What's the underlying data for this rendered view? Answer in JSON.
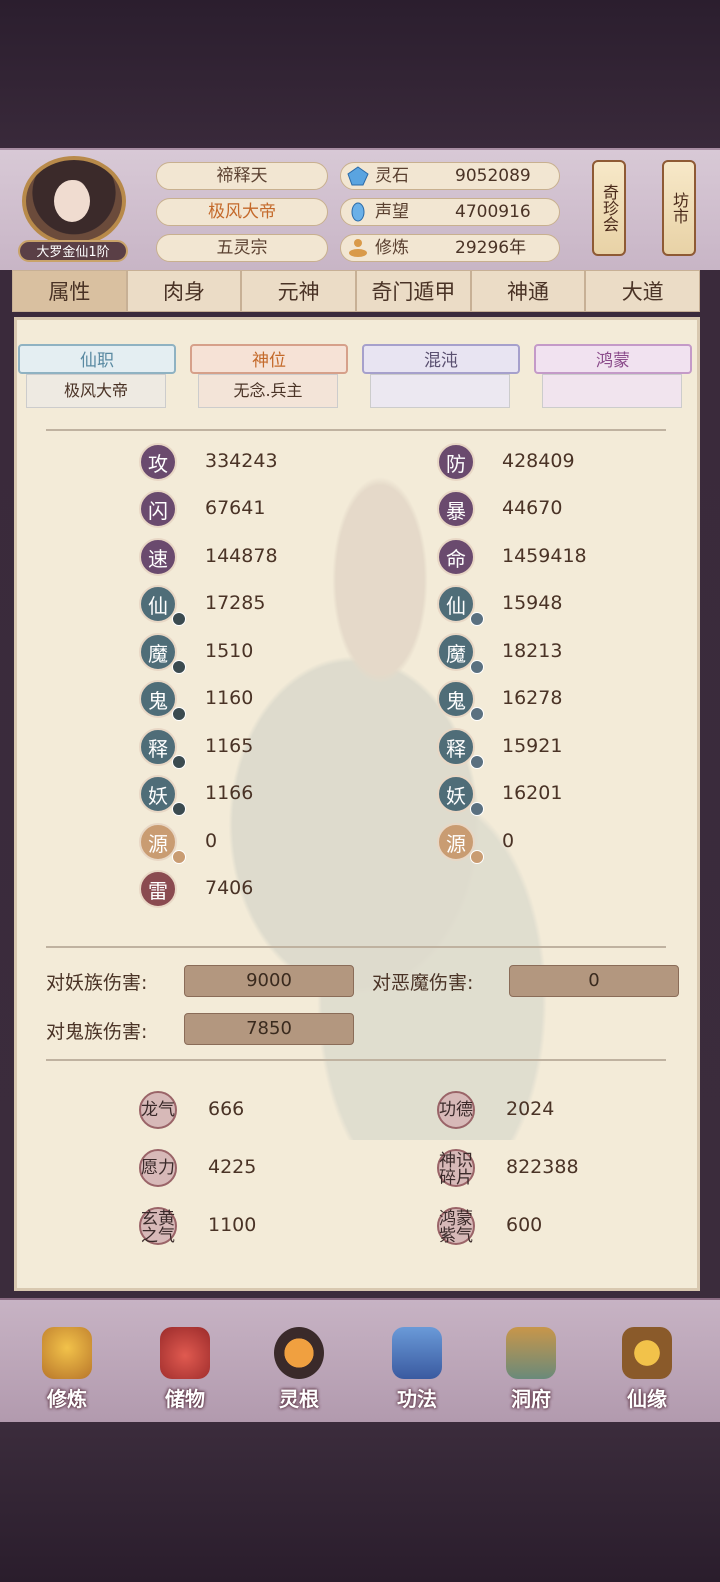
{
  "player": {
    "rank": "大罗金仙1阶",
    "name": "禘释天",
    "title": "极风大帝",
    "sect": "五灵宗"
  },
  "resources": [
    {
      "label": "灵石",
      "value": "9052089",
      "icon": "spirit-stone-icon"
    },
    {
      "label": "声望",
      "value": "4700916",
      "icon": "prestige-icon"
    },
    {
      "label": "修炼",
      "value": "29296年",
      "icon": "meditation-icon"
    }
  ],
  "side_buttons": {
    "treasure": "奇珍会",
    "market": "坊市"
  },
  "tabs": [
    "属性",
    "肉身",
    "元神",
    "奇门遁甲",
    "神通",
    "大道"
  ],
  "subtabs": [
    {
      "label": "仙职",
      "value": "极风大帝"
    },
    {
      "label": "神位",
      "value": "无念.兵主"
    },
    {
      "label": "混沌",
      "value": ""
    },
    {
      "label": "鸿蒙",
      "value": ""
    }
  ],
  "stats_left": [
    {
      "icon": "攻",
      "value": "334243"
    },
    {
      "icon": "闪",
      "value": "67641"
    },
    {
      "icon": "速",
      "value": "144878"
    },
    {
      "icon": "仙",
      "value": "17285"
    },
    {
      "icon": "魔",
      "value": "1510"
    },
    {
      "icon": "鬼",
      "value": "1160"
    },
    {
      "icon": "释",
      "value": "1165"
    },
    {
      "icon": "妖",
      "value": "1166"
    },
    {
      "icon": "源",
      "value": "0"
    },
    {
      "icon": "雷",
      "value": "7406"
    }
  ],
  "stats_right": [
    {
      "icon": "防",
      "value": "428409"
    },
    {
      "icon": "暴",
      "value": "44670"
    },
    {
      "icon": "命",
      "value": "1459418"
    },
    {
      "icon": "仙",
      "value": "15948"
    },
    {
      "icon": "魔",
      "value": "18213"
    },
    {
      "icon": "鬼",
      "value": "16278"
    },
    {
      "icon": "释",
      "value": "15921"
    },
    {
      "icon": "妖",
      "value": "16201"
    },
    {
      "icon": "源",
      "value": "0"
    }
  ],
  "damage": [
    {
      "label": "对妖族伤害:",
      "value": "9000"
    },
    {
      "label": "对恶魔伤害:",
      "value": "0"
    },
    {
      "label": "对鬼族伤害:",
      "value": "7850"
    }
  ],
  "extra": [
    {
      "icon": "龙气",
      "value": "666"
    },
    {
      "icon": "功德",
      "value": "2024"
    },
    {
      "icon": "愿力",
      "value": "4225"
    },
    {
      "icon": "神识碎片",
      "value": "822388"
    },
    {
      "icon": "玄黄之气",
      "value": "1100"
    },
    {
      "icon": "鸿蒙紫气",
      "value": "600"
    }
  ],
  "nav": [
    "修炼",
    "储物",
    "灵根",
    "功法",
    "洞府",
    "仙缘"
  ]
}
